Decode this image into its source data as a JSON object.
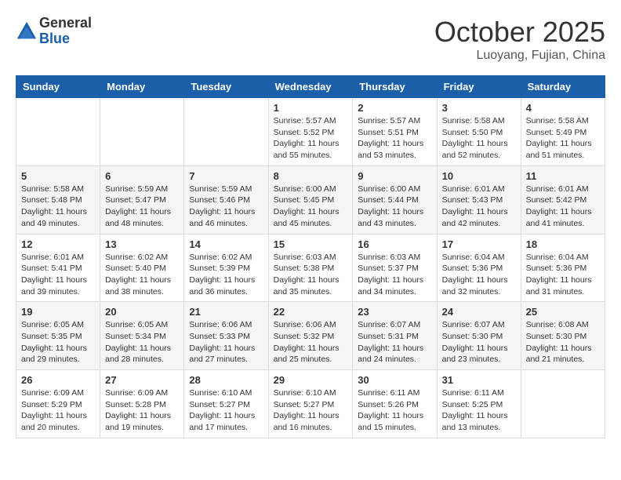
{
  "header": {
    "logo_general": "General",
    "logo_blue": "Blue",
    "month": "October 2025",
    "location": "Luoyang, Fujian, China"
  },
  "weekdays": [
    "Sunday",
    "Monday",
    "Tuesday",
    "Wednesday",
    "Thursday",
    "Friday",
    "Saturday"
  ],
  "weeks": [
    [
      {
        "day": "",
        "info": ""
      },
      {
        "day": "",
        "info": ""
      },
      {
        "day": "",
        "info": ""
      },
      {
        "day": "1",
        "info": "Sunrise: 5:57 AM\nSunset: 5:52 PM\nDaylight: 11 hours\nand 55 minutes."
      },
      {
        "day": "2",
        "info": "Sunrise: 5:57 AM\nSunset: 5:51 PM\nDaylight: 11 hours\nand 53 minutes."
      },
      {
        "day": "3",
        "info": "Sunrise: 5:58 AM\nSunset: 5:50 PM\nDaylight: 11 hours\nand 52 minutes."
      },
      {
        "day": "4",
        "info": "Sunrise: 5:58 AM\nSunset: 5:49 PM\nDaylight: 11 hours\nand 51 minutes."
      }
    ],
    [
      {
        "day": "5",
        "info": "Sunrise: 5:58 AM\nSunset: 5:48 PM\nDaylight: 11 hours\nand 49 minutes."
      },
      {
        "day": "6",
        "info": "Sunrise: 5:59 AM\nSunset: 5:47 PM\nDaylight: 11 hours\nand 48 minutes."
      },
      {
        "day": "7",
        "info": "Sunrise: 5:59 AM\nSunset: 5:46 PM\nDaylight: 11 hours\nand 46 minutes."
      },
      {
        "day": "8",
        "info": "Sunrise: 6:00 AM\nSunset: 5:45 PM\nDaylight: 11 hours\nand 45 minutes."
      },
      {
        "day": "9",
        "info": "Sunrise: 6:00 AM\nSunset: 5:44 PM\nDaylight: 11 hours\nand 43 minutes."
      },
      {
        "day": "10",
        "info": "Sunrise: 6:01 AM\nSunset: 5:43 PM\nDaylight: 11 hours\nand 42 minutes."
      },
      {
        "day": "11",
        "info": "Sunrise: 6:01 AM\nSunset: 5:42 PM\nDaylight: 11 hours\nand 41 minutes."
      }
    ],
    [
      {
        "day": "12",
        "info": "Sunrise: 6:01 AM\nSunset: 5:41 PM\nDaylight: 11 hours\nand 39 minutes."
      },
      {
        "day": "13",
        "info": "Sunrise: 6:02 AM\nSunset: 5:40 PM\nDaylight: 11 hours\nand 38 minutes."
      },
      {
        "day": "14",
        "info": "Sunrise: 6:02 AM\nSunset: 5:39 PM\nDaylight: 11 hours\nand 36 minutes."
      },
      {
        "day": "15",
        "info": "Sunrise: 6:03 AM\nSunset: 5:38 PM\nDaylight: 11 hours\nand 35 minutes."
      },
      {
        "day": "16",
        "info": "Sunrise: 6:03 AM\nSunset: 5:37 PM\nDaylight: 11 hours\nand 34 minutes."
      },
      {
        "day": "17",
        "info": "Sunrise: 6:04 AM\nSunset: 5:36 PM\nDaylight: 11 hours\nand 32 minutes."
      },
      {
        "day": "18",
        "info": "Sunrise: 6:04 AM\nSunset: 5:36 PM\nDaylight: 11 hours\nand 31 minutes."
      }
    ],
    [
      {
        "day": "19",
        "info": "Sunrise: 6:05 AM\nSunset: 5:35 PM\nDaylight: 11 hours\nand 29 minutes."
      },
      {
        "day": "20",
        "info": "Sunrise: 6:05 AM\nSunset: 5:34 PM\nDaylight: 11 hours\nand 28 minutes."
      },
      {
        "day": "21",
        "info": "Sunrise: 6:06 AM\nSunset: 5:33 PM\nDaylight: 11 hours\nand 27 minutes."
      },
      {
        "day": "22",
        "info": "Sunrise: 6:06 AM\nSunset: 5:32 PM\nDaylight: 11 hours\nand 25 minutes."
      },
      {
        "day": "23",
        "info": "Sunrise: 6:07 AM\nSunset: 5:31 PM\nDaylight: 11 hours\nand 24 minutes."
      },
      {
        "day": "24",
        "info": "Sunrise: 6:07 AM\nSunset: 5:30 PM\nDaylight: 11 hours\nand 23 minutes."
      },
      {
        "day": "25",
        "info": "Sunrise: 6:08 AM\nSunset: 5:30 PM\nDaylight: 11 hours\nand 21 minutes."
      }
    ],
    [
      {
        "day": "26",
        "info": "Sunrise: 6:09 AM\nSunset: 5:29 PM\nDaylight: 11 hours\nand 20 minutes."
      },
      {
        "day": "27",
        "info": "Sunrise: 6:09 AM\nSunset: 5:28 PM\nDaylight: 11 hours\nand 19 minutes."
      },
      {
        "day": "28",
        "info": "Sunrise: 6:10 AM\nSunset: 5:27 PM\nDaylight: 11 hours\nand 17 minutes."
      },
      {
        "day": "29",
        "info": "Sunrise: 6:10 AM\nSunset: 5:27 PM\nDaylight: 11 hours\nand 16 minutes."
      },
      {
        "day": "30",
        "info": "Sunrise: 6:11 AM\nSunset: 5:26 PM\nDaylight: 11 hours\nand 15 minutes."
      },
      {
        "day": "31",
        "info": "Sunrise: 6:11 AM\nSunset: 5:25 PM\nDaylight: 11 hours\nand 13 minutes."
      },
      {
        "day": "",
        "info": ""
      }
    ]
  ]
}
